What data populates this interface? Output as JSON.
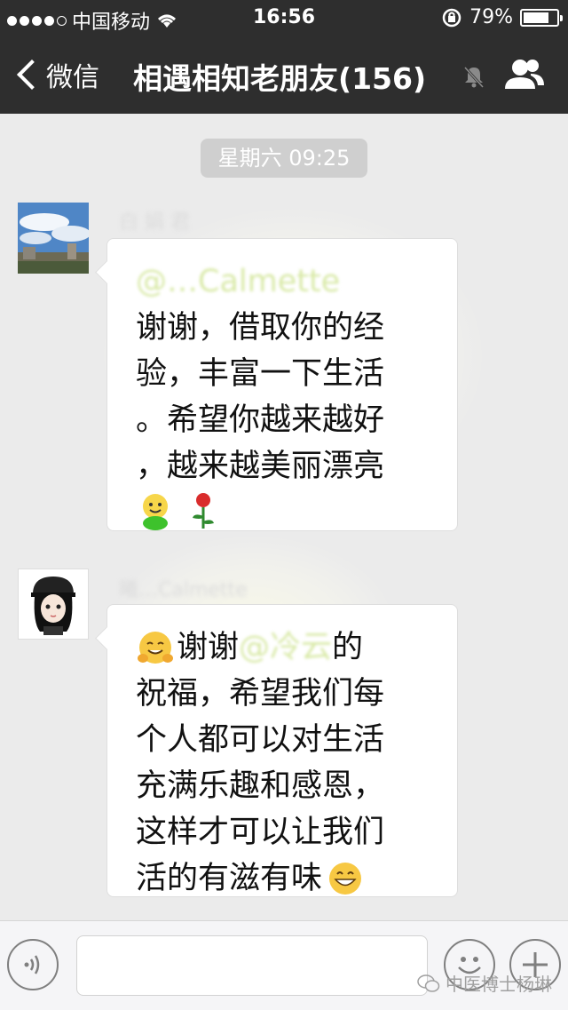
{
  "status_bar": {
    "carrier": "中国移动",
    "time": "16:56",
    "battery": "79%",
    "battery_level": 0.79
  },
  "nav": {
    "back_label": "微信",
    "title": "相遇相知老朋友(156)"
  },
  "chat": {
    "timestamp": "星期六 09:25",
    "messages": [
      {
        "sender": "白 娟 君",
        "mention": "@…Calmette",
        "lines": [
          "谢谢，借取你的经",
          "验，丰富一下生活",
          "。希望你越来越好",
          "，越来越美丽漂亮"
        ],
        "emojis": [
          "smiley-green",
          "rose"
        ]
      },
      {
        "sender": "曦…Calmette",
        "lines_first_prefix": "谢谢",
        "mention": "@冷云",
        "first_suffix": " 的",
        "lines": [
          "祝福，希望我们每",
          "个人都可以对生活",
          "充满乐趣和感恩，",
          "这样才可以让我们",
          "活的有滋有味"
        ],
        "emojis": [
          "hug",
          "grin"
        ]
      }
    ]
  },
  "input_bar": {
    "watermark": "中医博士杨琳"
  },
  "colors": {
    "header": "#2e2e2e",
    "background": "#ebebeb",
    "bubble": "#ffffff"
  }
}
